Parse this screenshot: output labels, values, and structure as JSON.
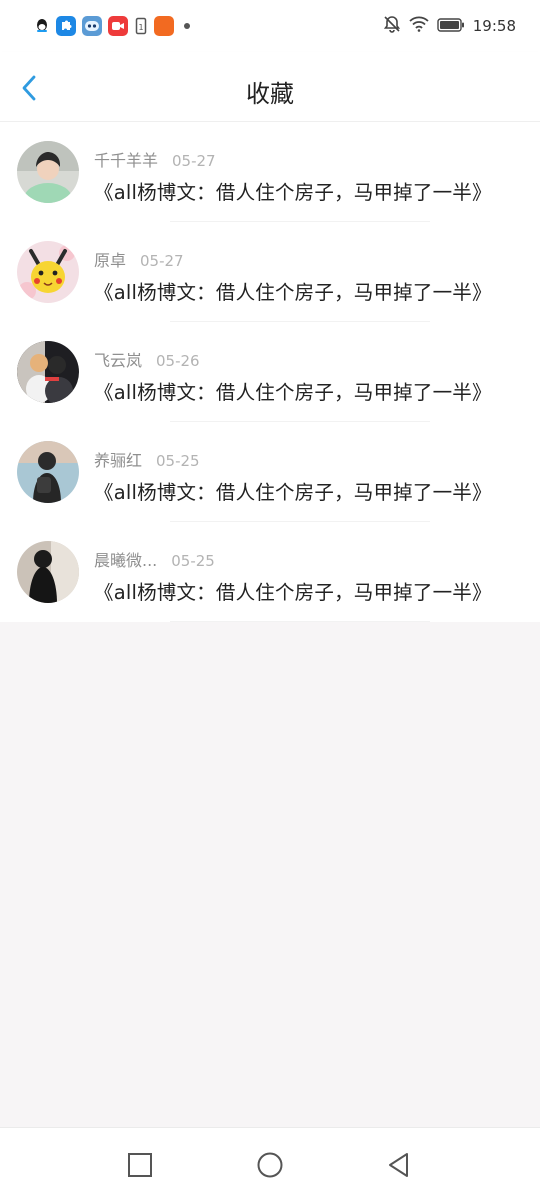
{
  "status_bar": {
    "time": "19:58",
    "left_icons": [
      "qq-icon",
      "puzzle-app-icon",
      "robot-app-icon",
      "video-app-icon",
      "sim-card-icon",
      "orange-app-icon",
      "more-dot-icon"
    ],
    "right_icons": [
      "bell-muted-icon",
      "wifi-icon",
      "battery-icon"
    ]
  },
  "header": {
    "title": "收藏",
    "back_icon": "chevron-left-icon",
    "accent": "#2f9be0"
  },
  "items": [
    {
      "author": "千千羊羊",
      "date": "05-27",
      "title": "《all杨博文：借人住个房子，马甲掉了一半》"
    },
    {
      "author": "原卓",
      "date": "05-27",
      "title": "《all杨博文：借人住个房子，马甲掉了一半》"
    },
    {
      "author": "飞云岚",
      "date": "05-26",
      "title": "《all杨博文：借人住个房子，马甲掉了一半》"
    },
    {
      "author": "养骊红",
      "date": "05-25",
      "title": "《all杨博文：借人住个房子，马甲掉了一半》"
    },
    {
      "author": "晨曦微...",
      "date": "05-25",
      "title": "《all杨博文：借人住个房子，马甲掉了一半》"
    }
  ],
  "nav": {
    "recent_icon": "square-icon",
    "home_icon": "circle-icon",
    "back_icon": "triangle-back-icon"
  }
}
